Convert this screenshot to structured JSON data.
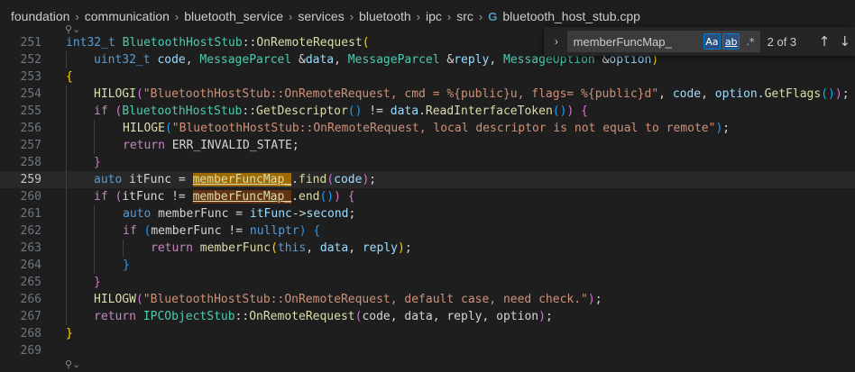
{
  "breadcrumb": {
    "segments": [
      "foundation",
      "communication",
      "bluetooth_service",
      "services",
      "bluetooth",
      "ipc",
      "src"
    ],
    "file_icon": "cpp-icon",
    "file_name": "bluetooth_host_stub.cpp"
  },
  "find": {
    "query": "memberFuncMap_",
    "match_case_label": "Aa",
    "whole_word_label": "ab",
    "regex_label": ".*",
    "match_count": "2 of 3",
    "prev_glyph": "↑",
    "next_glyph": "↓"
  },
  "editor": {
    "current_line": 259,
    "lines": [
      {
        "num": "251",
        "indent": 0,
        "tokens": [
          [
            "int32_t",
            "keyword"
          ],
          [
            " ",
            ""
          ],
          [
            "BluetoothHostStub",
            "type"
          ],
          [
            "::",
            ""
          ],
          [
            "OnRemoteRequest",
            "function"
          ],
          [
            "(",
            "brace1"
          ]
        ]
      },
      {
        "num": "252",
        "indent": 1,
        "tokens": [
          [
            "uint32_t",
            "keyword"
          ],
          [
            " ",
            ""
          ],
          [
            "code",
            "variable"
          ],
          [
            ", ",
            ""
          ],
          [
            "MessageParcel",
            "type"
          ],
          [
            " &",
            ""
          ],
          [
            "data",
            "variable"
          ],
          [
            ", ",
            ""
          ],
          [
            "MessageParcel",
            "type"
          ],
          [
            " &",
            ""
          ],
          [
            "reply",
            "variable"
          ],
          [
            ", ",
            ""
          ],
          [
            "MessageOption",
            "type"
          ],
          [
            " &",
            ""
          ],
          [
            "option",
            "variable"
          ],
          [
            ")",
            "brace1"
          ]
        ]
      },
      {
        "num": "253",
        "indent": 0,
        "tokens": [
          [
            "{",
            "brace1"
          ]
        ]
      },
      {
        "num": "254",
        "indent": 1,
        "tokens": [
          [
            "HILOGI",
            "function"
          ],
          [
            "(",
            "brace2"
          ],
          [
            "\"BluetoothHostStub::OnRemoteRequest, cmd = %{public}u, flags= %{public}d\"",
            "string"
          ],
          [
            ", ",
            ""
          ],
          [
            "code",
            "variable"
          ],
          [
            ", ",
            ""
          ],
          [
            "option",
            "variable"
          ],
          [
            ".",
            ""
          ],
          [
            "GetFlags",
            "function"
          ],
          [
            "()",
            "brace3"
          ],
          [
            ")",
            "brace2"
          ],
          [
            ";",
            ""
          ]
        ]
      },
      {
        "num": "255",
        "indent": 1,
        "tokens": [
          [
            "if",
            "control"
          ],
          [
            " ",
            ""
          ],
          [
            "(",
            "brace2"
          ],
          [
            "BluetoothHostStub",
            "type"
          ],
          [
            "::",
            ""
          ],
          [
            "GetDescriptor",
            "function"
          ],
          [
            "()",
            "brace3"
          ],
          [
            " != ",
            ""
          ],
          [
            "data",
            "variable"
          ],
          [
            ".",
            ""
          ],
          [
            "ReadInterfaceToken",
            "function"
          ],
          [
            "()",
            "brace3"
          ],
          [
            ")",
            "brace2"
          ],
          [
            " ",
            ""
          ],
          [
            "{",
            "brace2"
          ]
        ]
      },
      {
        "num": "256",
        "indent": 2,
        "tokens": [
          [
            "HILOGE",
            "function"
          ],
          [
            "(",
            "brace3"
          ],
          [
            "\"BluetoothHostStub::OnRemoteRequest, local descriptor is not equal to remote\"",
            "string"
          ],
          [
            ")",
            "brace3"
          ],
          [
            ";",
            ""
          ]
        ]
      },
      {
        "num": "257",
        "indent": 2,
        "tokens": [
          [
            "return",
            "control"
          ],
          [
            " ERR_INVALID_STATE;",
            ""
          ]
        ]
      },
      {
        "num": "258",
        "indent": 1,
        "tokens": [
          [
            "}",
            "brace2"
          ]
        ]
      },
      {
        "num": "259",
        "indent": 1,
        "tokens": [
          [
            "auto",
            "keyword"
          ],
          [
            " itFunc = ",
            ""
          ],
          [
            "memberFuncMap_",
            "match-active"
          ],
          [
            ".",
            ""
          ],
          [
            "find",
            "function"
          ],
          [
            "(",
            "brace2"
          ],
          [
            "code",
            "variable"
          ],
          [
            ")",
            "brace2"
          ],
          [
            ";",
            ""
          ]
        ]
      },
      {
        "num": "260",
        "indent": 1,
        "tokens": [
          [
            "if",
            "control"
          ],
          [
            " ",
            ""
          ],
          [
            "(",
            "brace2"
          ],
          [
            "itFunc != ",
            ""
          ],
          [
            "memberFuncMap_",
            "match"
          ],
          [
            ".",
            ""
          ],
          [
            "end",
            "function"
          ],
          [
            "()",
            "brace3"
          ],
          [
            ")",
            "brace2"
          ],
          [
            " ",
            ""
          ],
          [
            "{",
            "brace2"
          ]
        ]
      },
      {
        "num": "261",
        "indent": 2,
        "tokens": [
          [
            "auto",
            "keyword"
          ],
          [
            " memberFunc = ",
            ""
          ],
          [
            "itFunc",
            "variable"
          ],
          [
            "->",
            ""
          ],
          [
            "second",
            "variable"
          ],
          [
            ";",
            ""
          ]
        ]
      },
      {
        "num": "262",
        "indent": 2,
        "tokens": [
          [
            "if",
            "control"
          ],
          [
            " ",
            ""
          ],
          [
            "(",
            "brace3"
          ],
          [
            "memberFunc != ",
            ""
          ],
          [
            "nullptr",
            "keyword"
          ],
          [
            ")",
            "brace3"
          ],
          [
            " ",
            ""
          ],
          [
            "{",
            "brace3"
          ]
        ]
      },
      {
        "num": "263",
        "indent": 3,
        "tokens": [
          [
            "return",
            "control"
          ],
          [
            " ",
            ""
          ],
          [
            "memberFunc",
            "function"
          ],
          [
            "(",
            "brace1"
          ],
          [
            "this",
            "keyword"
          ],
          [
            ", ",
            ""
          ],
          [
            "data",
            "variable"
          ],
          [
            ", ",
            ""
          ],
          [
            "reply",
            "variable"
          ],
          [
            ")",
            "brace1"
          ],
          [
            ";",
            ""
          ]
        ]
      },
      {
        "num": "264",
        "indent": 2,
        "tokens": [
          [
            "}",
            "brace3"
          ]
        ]
      },
      {
        "num": "265",
        "indent": 1,
        "tokens": [
          [
            "}",
            "brace2"
          ]
        ]
      },
      {
        "num": "266",
        "indent": 1,
        "tokens": [
          [
            "HILOGW",
            "function"
          ],
          [
            "(",
            "brace2"
          ],
          [
            "\"BluetoothHostStub::OnRemoteRequest, default case, need check.\"",
            "string"
          ],
          [
            ")",
            "brace2"
          ],
          [
            ";",
            ""
          ]
        ]
      },
      {
        "num": "267",
        "indent": 1,
        "tokens": [
          [
            "return",
            "control"
          ],
          [
            " ",
            ""
          ],
          [
            "IPCObjectStub",
            "type"
          ],
          [
            "::",
            ""
          ],
          [
            "OnRemoteRequest",
            "function"
          ],
          [
            "(",
            "brace2"
          ],
          [
            "code, data, reply, option",
            ""
          ],
          [
            ")",
            "brace2"
          ],
          [
            ";",
            ""
          ]
        ]
      },
      {
        "num": "268",
        "indent": 0,
        "tokens": [
          [
            "}",
            "brace1"
          ]
        ]
      },
      {
        "num": "269",
        "indent": 0,
        "tokens": []
      }
    ]
  },
  "colors": {
    "background": "#1e1e1e",
    "find_match": "#613214",
    "find_match_active": "#9e6a03",
    "toggle_active": "#007acc"
  }
}
